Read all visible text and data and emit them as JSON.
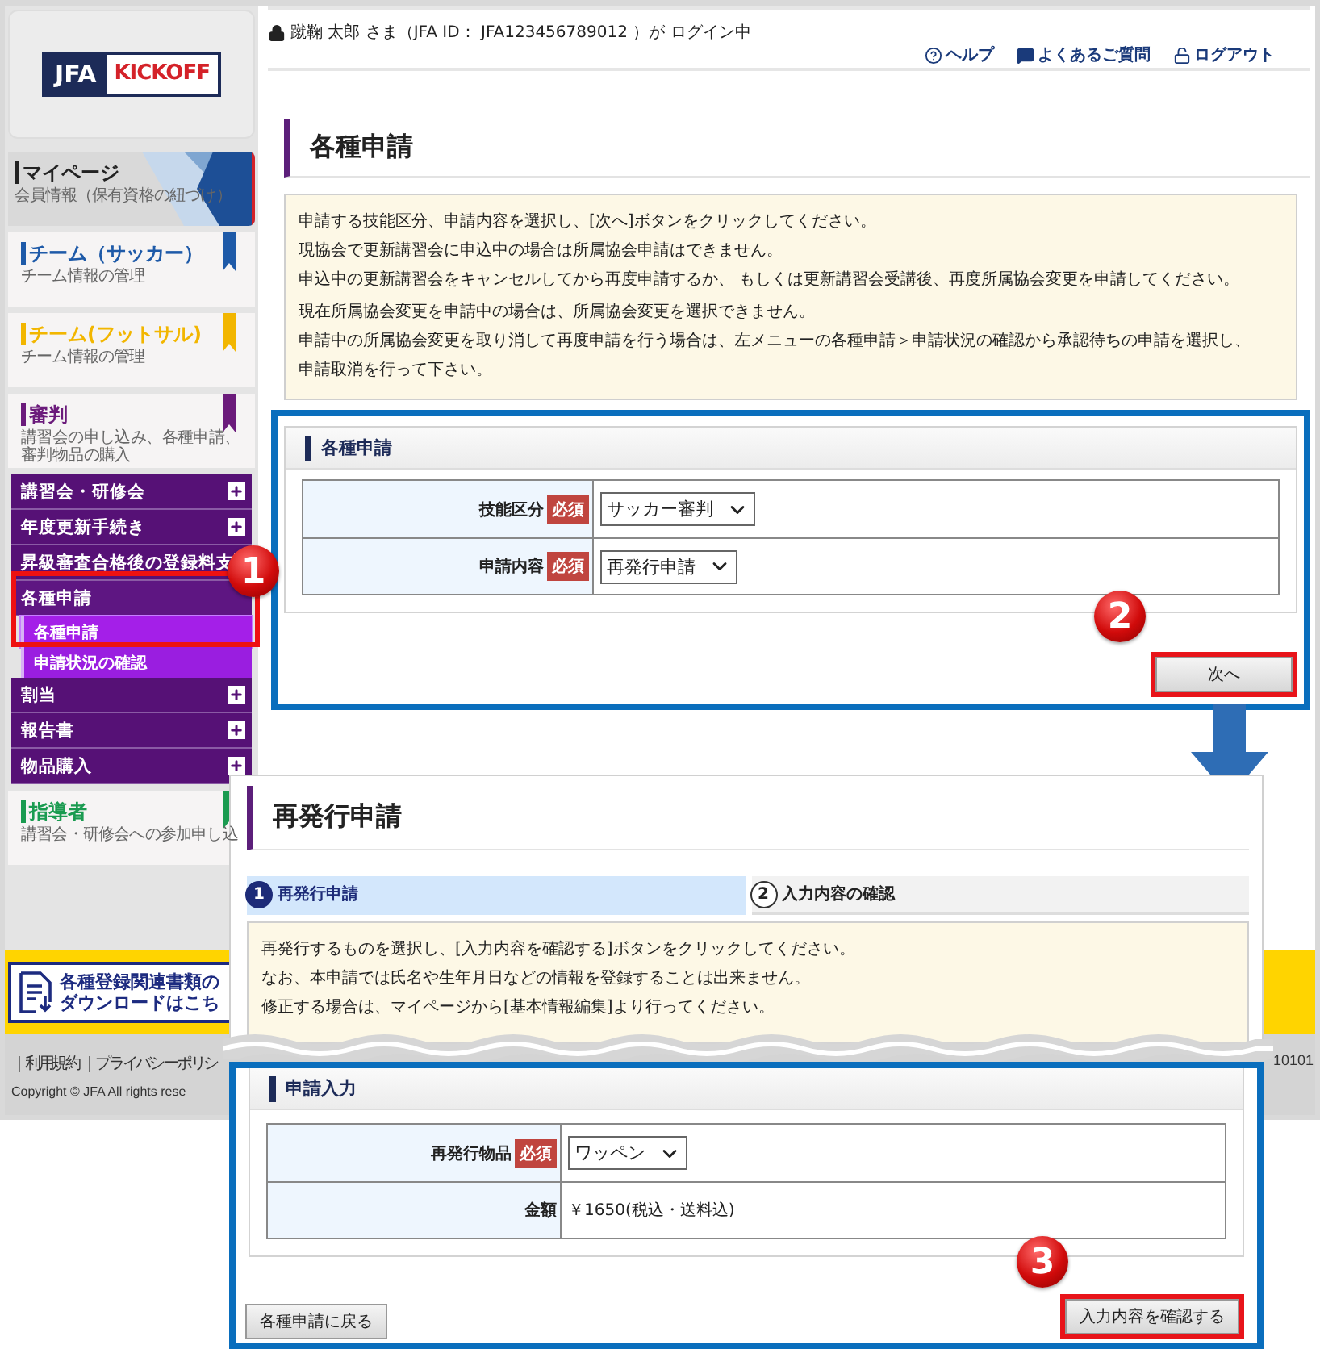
{
  "header": {
    "login_text": "蹴鞠 太郎 さま（JFA ID： JFA123456789012 ）が ログイン中",
    "links": [
      {
        "kind": "help",
        "label": "ヘルプ"
      },
      {
        "kind": "faq",
        "label": "よくあるご質問"
      },
      {
        "kind": "logout",
        "label": "ログアウト"
      }
    ]
  },
  "logo": {
    "left": "JFA",
    "right": "KICKOFF"
  },
  "sidebar": {
    "sections": [
      {
        "kind": "mypage",
        "title": "マイページ",
        "subtitle": "会員情報（保有資格の紐づけ）",
        "color": "#222222"
      },
      {
        "kind": "ribbon",
        "title": "チーム（サッカー）",
        "subtitle": "チーム情報の管理",
        "color": "#1e5aa8"
      },
      {
        "kind": "ribbon",
        "title": "チーム(フットサル)",
        "subtitle": "チーム情報の管理",
        "color": "#f2b600"
      },
      {
        "kind": "ribbon",
        "title": "審判",
        "subtitle": "講習会の申し込み、各種申請、審判物品の購入",
        "color": "#6b1b7b"
      }
    ],
    "menu": [
      {
        "label": "講習会・研修会",
        "expanded": false
      },
      {
        "label": "年度更新手続き",
        "expanded": false
      },
      {
        "label": "昇級審査合格後の登録料支",
        "expanded": false
      },
      {
        "label": "各種申請",
        "expanded": true,
        "children": [
          {
            "label": "各種申請",
            "selected": true
          },
          {
            "label": "申請状況の確認",
            "selected": false
          }
        ]
      },
      {
        "label": "割当",
        "expanded": false
      },
      {
        "label": "報告書",
        "expanded": false
      },
      {
        "label": "物品購入",
        "expanded": false
      }
    ],
    "after_sections": [
      {
        "kind": "ribbon",
        "title": "指導者",
        "subtitle": "講習会・研修会への参加申し込",
        "color": "#1a9b50"
      }
    ]
  },
  "banner": {
    "lines": [
      "各種登録関連書類の",
      "ダウンロードはこち"
    ]
  },
  "footer": {
    "links_text": "｜利用規約 ｜プライバシーポリシ",
    "copyright": "Copyright © JFA All rights rese",
    "code": "10101"
  },
  "page": {
    "title": "各種申請",
    "notice": [
      "申請する技能区分、申請内容を選択し、[次へ]ボタンをクリックしてください。",
      "現協会で更新講習会に申込中の場合は所属協会申請はできません。",
      "申込中の更新講習会をキャンセルしてから再度申請するか、 もしくは更新講習会受講後、再度所属協会変更を申請してください。",
      "現在所属協会変更を申請中の場合は、所属協会変更を選択できません。",
      "申請中の所属協会変更を取り消して再度申請を行う場合は、左メニューの各種申請＞申請状況の確認から承認待ちの申請を選択し、",
      "申請取消を行って下さい。"
    ],
    "form": {
      "heading": "各種申請",
      "fields": [
        {
          "kind": "select",
          "label": "技能区分",
          "required": "必須",
          "value": "サッカー審判"
        },
        {
          "kind": "select",
          "label": "申請内容",
          "required": "必須",
          "value": "再発行申請"
        }
      ]
    },
    "next_button": "次へ"
  },
  "overlay": {
    "title": "再発行申請",
    "steps": [
      {
        "number": "1",
        "label": "再発行申請",
        "selected": true
      },
      {
        "number": "2",
        "label": "入力内容の確認",
        "selected": false
      }
    ],
    "notice": [
      "再発行するものを選択し、[入力内容を確認する]ボタンをクリックしてください。",
      "なお、本申請では氏名や生年月日などの情報を登録することは出来ません。",
      "修正する場合は、マイページから[基本情報編集]より行ってください。"
    ],
    "form": {
      "heading": "申請入力",
      "fields": [
        {
          "kind": "select",
          "label": "再発行物品",
          "required": "必須",
          "value": "ワッペン"
        },
        {
          "kind": "text",
          "label": "金額",
          "value": "￥1650(税込・送料込)"
        }
      ]
    },
    "back_button": "各種申請に戻る",
    "confirm_button": "入力内容を確認する"
  },
  "callouts": [
    "1",
    "2",
    "3"
  ]
}
